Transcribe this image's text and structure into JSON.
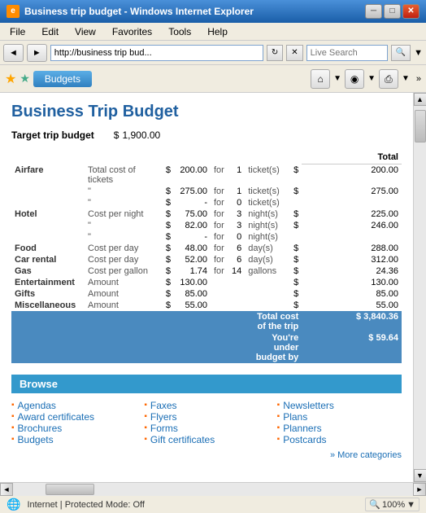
{
  "window": {
    "title": "Business trip budget - Windows Internet Explorer",
    "icon": "e"
  },
  "titlebar": {
    "minimize_label": "─",
    "maximize_label": "□",
    "close_label": "✕"
  },
  "menubar": {
    "items": [
      "File",
      "Edit",
      "View",
      "Favorites",
      "Tools",
      "Help"
    ]
  },
  "addressbar": {
    "back_label": "◄",
    "forward_label": "►",
    "address": "http://business trip bud...",
    "refresh_label": "↻",
    "stop_label": "✕",
    "search_placeholder": "Live Search"
  },
  "toolbar": {
    "favorites_label": "★",
    "tab_label": "Budgets",
    "home_label": "⌂",
    "rss_label": "◉",
    "print_label": "⎙",
    "more_label": "»"
  },
  "budget": {
    "title": "Business Trip Budget",
    "target_label": "Target trip budget",
    "target_currency": "$",
    "target_value": "1,900.00",
    "total_header": "Total",
    "rows": [
      {
        "category": "Airfare",
        "description": "Total cost of tickets",
        "currency": "$",
        "amount": "200.00",
        "for_word": "for",
        "quantity": "1",
        "unit": "ticket(s)",
        "total_currency": "$",
        "total": "200.00"
      },
      {
        "category": "",
        "description": "\"",
        "currency": "$",
        "amount": "275.00",
        "for_word": "for",
        "quantity": "1",
        "unit": "ticket(s)",
        "total_currency": "$",
        "total": "275.00"
      },
      {
        "category": "",
        "description": "\"",
        "currency": "$",
        "amount": "-",
        "for_word": "for",
        "quantity": "0",
        "unit": "ticket(s)",
        "total_currency": "",
        "total": ""
      },
      {
        "category": "Hotel",
        "description": "Cost per night",
        "currency": "$",
        "amount": "75.00",
        "for_word": "for",
        "quantity": "3",
        "unit": "night(s)",
        "total_currency": "$",
        "total": "225.00"
      },
      {
        "category": "",
        "description": "\"",
        "currency": "$",
        "amount": "82.00",
        "for_word": "for",
        "quantity": "3",
        "unit": "night(s)",
        "total_currency": "$",
        "total": "246.00"
      },
      {
        "category": "",
        "description": "\"",
        "currency": "$",
        "amount": "-",
        "for_word": "for",
        "quantity": "0",
        "unit": "night(s)",
        "total_currency": "",
        "total": ""
      },
      {
        "category": "Food",
        "description": "Cost per day",
        "currency": "$",
        "amount": "48.00",
        "for_word": "for",
        "quantity": "6",
        "unit": "day(s)",
        "total_currency": "$",
        "total": "288.00"
      },
      {
        "category": "Car rental",
        "description": "Cost per day",
        "currency": "$",
        "amount": "52.00",
        "for_word": "for",
        "quantity": "6",
        "unit": "day(s)",
        "total_currency": "$",
        "total": "312.00"
      },
      {
        "category": "Gas",
        "description": "Cost per gallon",
        "currency": "$",
        "amount": "1.74",
        "for_word": "for",
        "quantity": "14",
        "unit": "gallons",
        "total_currency": "$",
        "total": "24.36"
      },
      {
        "category": "Entertainment",
        "description": "Amount",
        "currency": "$",
        "amount": "130.00",
        "for_word": "",
        "quantity": "",
        "unit": "",
        "total_currency": "$",
        "total": "130.00"
      },
      {
        "category": "Gifts",
        "description": "Amount",
        "currency": "$",
        "amount": "85.00",
        "for_word": "",
        "quantity": "",
        "unit": "",
        "total_currency": "$",
        "total": "85.00"
      },
      {
        "category": "Miscellaneous",
        "description": "Amount",
        "currency": "$",
        "amount": "55.00",
        "for_word": "",
        "quantity": "",
        "unit": "",
        "total_currency": "$",
        "total": "55.00"
      }
    ],
    "total_cost_label": "Total cost of the trip",
    "total_cost_currency": "$",
    "total_cost_value": "3,840.36",
    "under_budget_label": "You're under budget by",
    "under_budget_currency": "$",
    "under_budget_value": "59.64"
  },
  "browse": {
    "header": "Browse",
    "items_col1": [
      "Agendas",
      "Award certificates",
      "Brochures",
      "Budgets"
    ],
    "items_col2": [
      "Faxes",
      "Flyers",
      "Forms",
      "Gift certificates"
    ],
    "items_col3": [
      "Newsletters",
      "Plans",
      "Planners",
      "Postcards"
    ],
    "more_label": "» More categories"
  },
  "statusbar": {
    "icon": "🌐",
    "text": "Internet | Protected Mode: Off",
    "zoom": "🔍 100%",
    "zoom_arrow": "▼"
  }
}
